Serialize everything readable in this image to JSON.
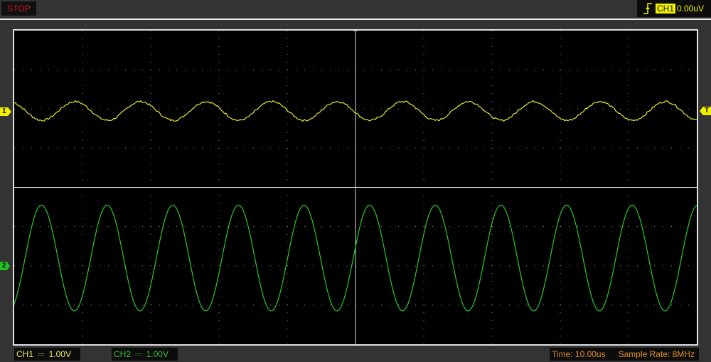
{
  "status": {
    "run_state": "STOP"
  },
  "trigger": {
    "source": "CH1",
    "level": "0.00uV",
    "edge_icon": "rising-edge-icon",
    "marker": "T"
  },
  "channels": [
    {
      "name": "CH1",
      "marker": "1",
      "coupling_icon": "dc-coupling-icon",
      "coupling_glyph": "⎓",
      "volts_per_div": "1.00V",
      "color": "#e6e632"
    },
    {
      "name": "CH2",
      "marker": "2",
      "coupling_icon": "dc-coupling-icon",
      "coupling_glyph": "⎓",
      "volts_per_div": "1.00V",
      "color": "#28c828"
    }
  ],
  "timebase": {
    "label": "Time: 10.00us",
    "sample_rate": "Sample Rate: 8MHz"
  },
  "chart_data": {
    "type": "line",
    "x_unit": "us",
    "xlim": [
      0,
      100
    ],
    "x_divisions": 10,
    "y_divisions": 8,
    "series": [
      {
        "name": "CH1",
        "frequency_khz": 104,
        "amplitude_div": 0.24,
        "offset_div": 1.95,
        "peak_time_us": 18.5
      },
      {
        "name": "CH2",
        "frequency_khz": 104,
        "amplitude_div": 1.35,
        "offset_div": -1.8,
        "peak_time_us": 4
      }
    ]
  }
}
